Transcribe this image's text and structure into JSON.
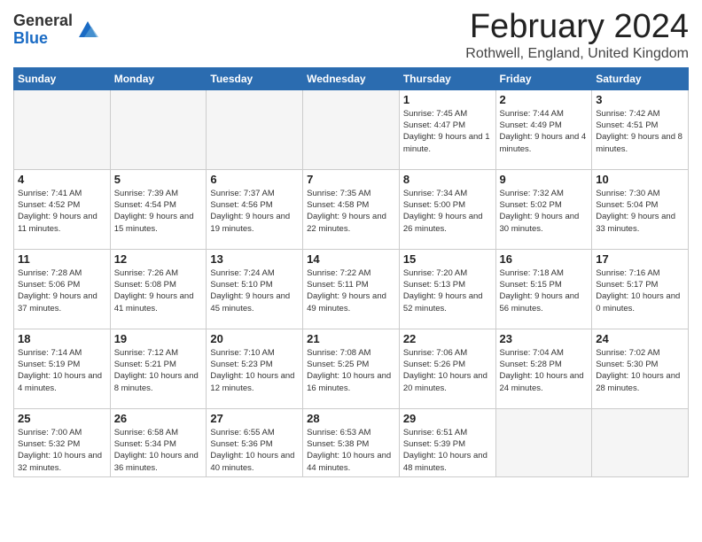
{
  "header": {
    "logo_general": "General",
    "logo_blue": "Blue",
    "month_title": "February 2024",
    "location": "Rothwell, England, United Kingdom"
  },
  "days_of_week": [
    "Sunday",
    "Monday",
    "Tuesday",
    "Wednesday",
    "Thursday",
    "Friday",
    "Saturday"
  ],
  "weeks": [
    [
      {
        "day": "",
        "info": ""
      },
      {
        "day": "",
        "info": ""
      },
      {
        "day": "",
        "info": ""
      },
      {
        "day": "",
        "info": ""
      },
      {
        "day": "1",
        "info": "Sunrise: 7:45 AM\nSunset: 4:47 PM\nDaylight: 9 hours and 1 minute."
      },
      {
        "day": "2",
        "info": "Sunrise: 7:44 AM\nSunset: 4:49 PM\nDaylight: 9 hours and 4 minutes."
      },
      {
        "day": "3",
        "info": "Sunrise: 7:42 AM\nSunset: 4:51 PM\nDaylight: 9 hours and 8 minutes."
      }
    ],
    [
      {
        "day": "4",
        "info": "Sunrise: 7:41 AM\nSunset: 4:52 PM\nDaylight: 9 hours and 11 minutes."
      },
      {
        "day": "5",
        "info": "Sunrise: 7:39 AM\nSunset: 4:54 PM\nDaylight: 9 hours and 15 minutes."
      },
      {
        "day": "6",
        "info": "Sunrise: 7:37 AM\nSunset: 4:56 PM\nDaylight: 9 hours and 19 minutes."
      },
      {
        "day": "7",
        "info": "Sunrise: 7:35 AM\nSunset: 4:58 PM\nDaylight: 9 hours and 22 minutes."
      },
      {
        "day": "8",
        "info": "Sunrise: 7:34 AM\nSunset: 5:00 PM\nDaylight: 9 hours and 26 minutes."
      },
      {
        "day": "9",
        "info": "Sunrise: 7:32 AM\nSunset: 5:02 PM\nDaylight: 9 hours and 30 minutes."
      },
      {
        "day": "10",
        "info": "Sunrise: 7:30 AM\nSunset: 5:04 PM\nDaylight: 9 hours and 33 minutes."
      }
    ],
    [
      {
        "day": "11",
        "info": "Sunrise: 7:28 AM\nSunset: 5:06 PM\nDaylight: 9 hours and 37 minutes."
      },
      {
        "day": "12",
        "info": "Sunrise: 7:26 AM\nSunset: 5:08 PM\nDaylight: 9 hours and 41 minutes."
      },
      {
        "day": "13",
        "info": "Sunrise: 7:24 AM\nSunset: 5:10 PM\nDaylight: 9 hours and 45 minutes."
      },
      {
        "day": "14",
        "info": "Sunrise: 7:22 AM\nSunset: 5:11 PM\nDaylight: 9 hours and 49 minutes."
      },
      {
        "day": "15",
        "info": "Sunrise: 7:20 AM\nSunset: 5:13 PM\nDaylight: 9 hours and 52 minutes."
      },
      {
        "day": "16",
        "info": "Sunrise: 7:18 AM\nSunset: 5:15 PM\nDaylight: 9 hours and 56 minutes."
      },
      {
        "day": "17",
        "info": "Sunrise: 7:16 AM\nSunset: 5:17 PM\nDaylight: 10 hours and 0 minutes."
      }
    ],
    [
      {
        "day": "18",
        "info": "Sunrise: 7:14 AM\nSunset: 5:19 PM\nDaylight: 10 hours and 4 minutes."
      },
      {
        "day": "19",
        "info": "Sunrise: 7:12 AM\nSunset: 5:21 PM\nDaylight: 10 hours and 8 minutes."
      },
      {
        "day": "20",
        "info": "Sunrise: 7:10 AM\nSunset: 5:23 PM\nDaylight: 10 hours and 12 minutes."
      },
      {
        "day": "21",
        "info": "Sunrise: 7:08 AM\nSunset: 5:25 PM\nDaylight: 10 hours and 16 minutes."
      },
      {
        "day": "22",
        "info": "Sunrise: 7:06 AM\nSunset: 5:26 PM\nDaylight: 10 hours and 20 minutes."
      },
      {
        "day": "23",
        "info": "Sunrise: 7:04 AM\nSunset: 5:28 PM\nDaylight: 10 hours and 24 minutes."
      },
      {
        "day": "24",
        "info": "Sunrise: 7:02 AM\nSunset: 5:30 PM\nDaylight: 10 hours and 28 minutes."
      }
    ],
    [
      {
        "day": "25",
        "info": "Sunrise: 7:00 AM\nSunset: 5:32 PM\nDaylight: 10 hours and 32 minutes."
      },
      {
        "day": "26",
        "info": "Sunrise: 6:58 AM\nSunset: 5:34 PM\nDaylight: 10 hours and 36 minutes."
      },
      {
        "day": "27",
        "info": "Sunrise: 6:55 AM\nSunset: 5:36 PM\nDaylight: 10 hours and 40 minutes."
      },
      {
        "day": "28",
        "info": "Sunrise: 6:53 AM\nSunset: 5:38 PM\nDaylight: 10 hours and 44 minutes."
      },
      {
        "day": "29",
        "info": "Sunrise: 6:51 AM\nSunset: 5:39 PM\nDaylight: 10 hours and 48 minutes."
      },
      {
        "day": "",
        "info": ""
      },
      {
        "day": "",
        "info": ""
      }
    ]
  ]
}
